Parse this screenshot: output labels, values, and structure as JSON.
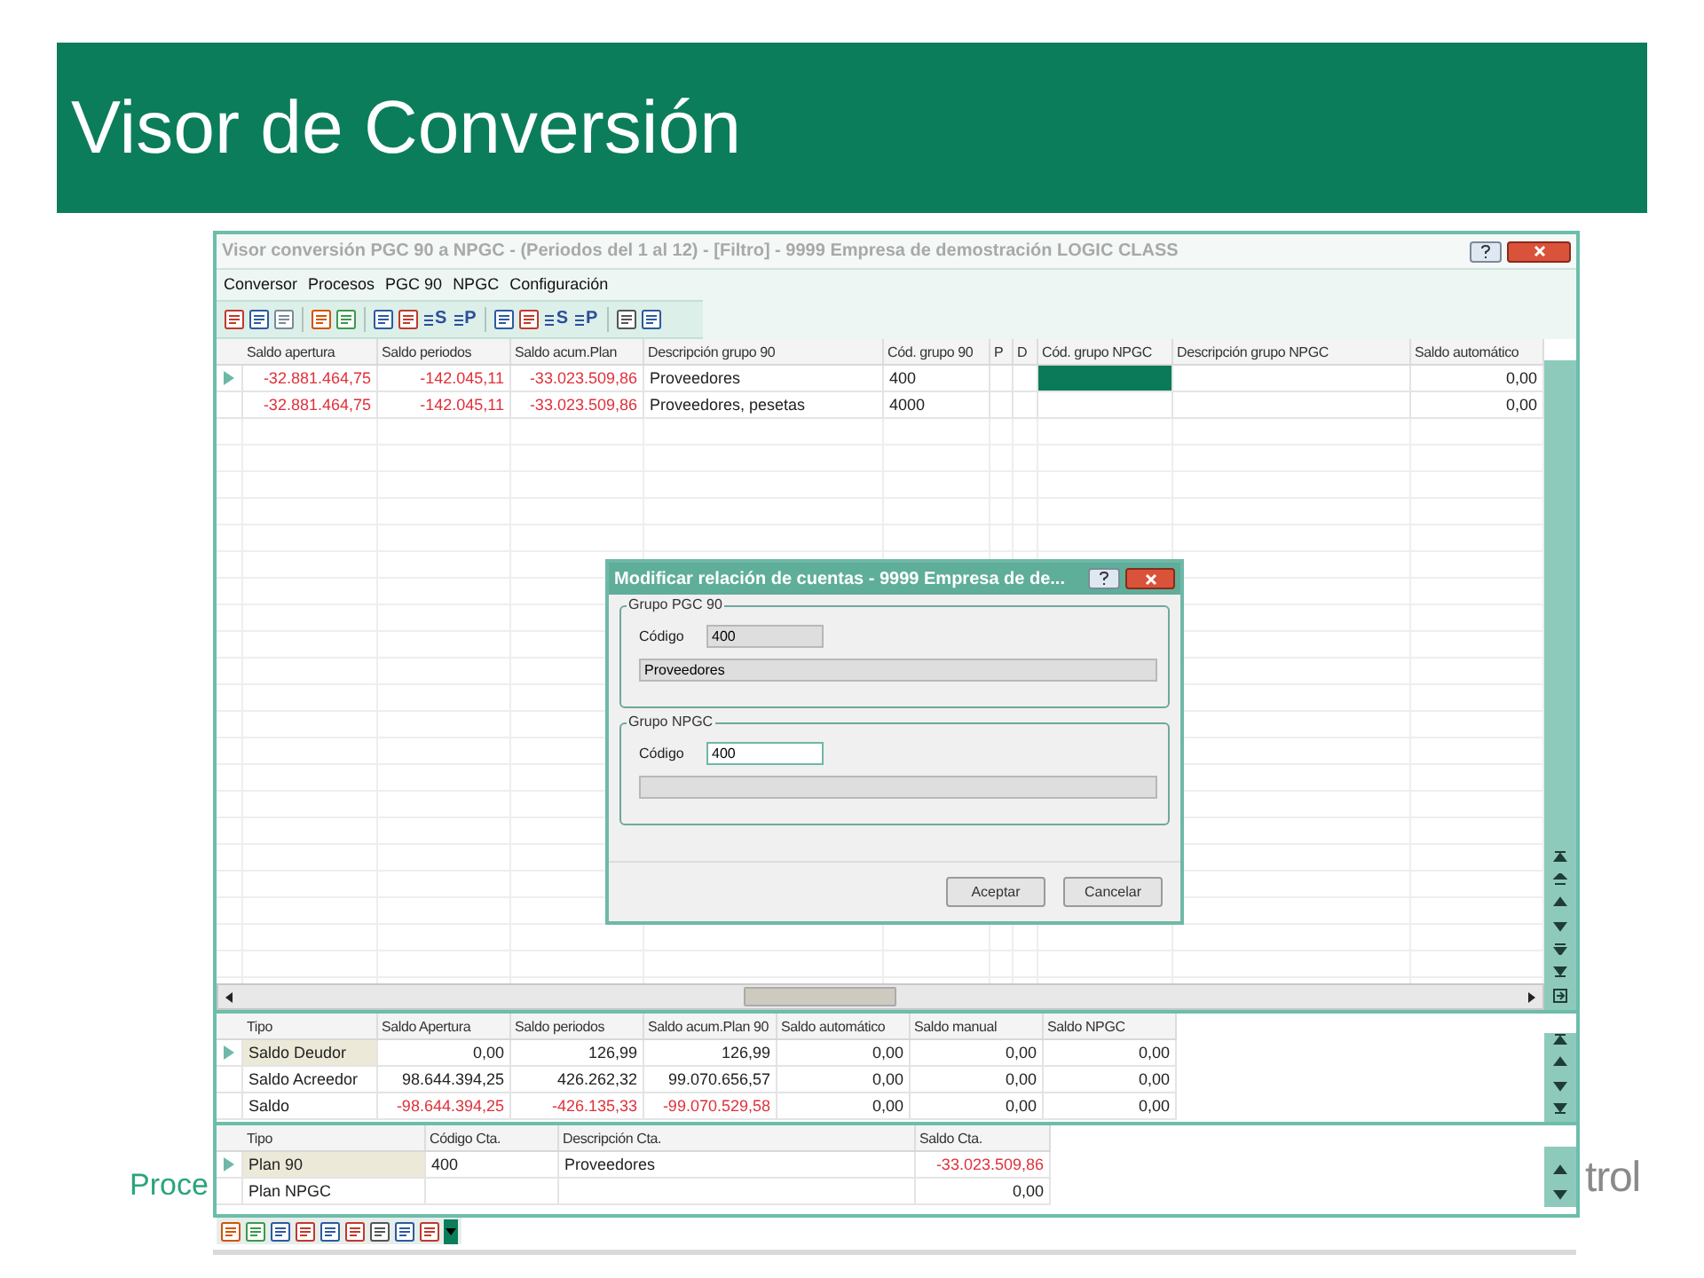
{
  "slide": {
    "title": "Visor de Conversión",
    "footer_left": "Proce",
    "footer_right": "trol"
  },
  "window": {
    "title": "Visor conversión PGC 90 a NPGC - (Periodos del 1 al 12) - [Filtro] - 9999 Empresa de demostración LOGIC CLASS"
  },
  "menu": [
    "Conversor",
    "Procesos",
    "PGC 90",
    "NPGC",
    "Configuración"
  ],
  "toolbar_labels": [
    "S",
    "P",
    "S",
    "P"
  ],
  "grid": {
    "columns": [
      "Saldo apertura",
      "Saldo periodos",
      "Saldo acum.Plan",
      "Descripción grupo 90",
      "Cód. grupo 90",
      "P",
      "D",
      "Cód. grupo NPGC",
      "Descripción grupo NPGC",
      "Saldo automático"
    ],
    "rows": [
      {
        "selected": true,
        "negative": true,
        "saldo_apertura": "-32.881.464,75",
        "saldo_periodos": "-142.045,11",
        "saldo_acum_plan": "-33.023.509,86",
        "descripcion_grupo_90": "Proveedores",
        "cod_grupo_90": "400",
        "saldo_automatico": "0,00"
      },
      {
        "selected": false,
        "negative": true,
        "saldo_apertura": "-32.881.464,75",
        "saldo_periodos": "-142.045,11",
        "saldo_acum_plan": "-33.023.509,86",
        "descripcion_grupo_90": "Proveedores, pesetas",
        "cod_grupo_90": "4000",
        "saldo_automatico": "0,00"
      }
    ]
  },
  "dialog": {
    "title": "Modificar relación de cuentas - 9999 Empresa de de...",
    "groups": [
      {
        "legend": "Grupo PGC 90",
        "code_label": "Código",
        "code_value": "400",
        "description_value": "Proveedores",
        "editable": false
      },
      {
        "legend": "Grupo NPGC",
        "code_label": "Código",
        "code_value": "400",
        "editable": true
      }
    ],
    "buttons": [
      "Aceptar",
      "Cancelar"
    ]
  },
  "summary": {
    "columns": [
      "Tipo",
      "Saldo Apertura",
      "Saldo periodos",
      "Saldo acum.Plan 90",
      "Saldo automático",
      "Saldo manual",
      "Saldo NPGC"
    ],
    "rows": [
      {
        "selected": true,
        "negative": false,
        "tipo": "Saldo Deudor",
        "saldo_apertura": "0,00",
        "saldo_periodos": "126,99",
        "saldo_acum_plan": "126,99",
        "saldo_automatico": "0,00",
        "saldo_manual": "0,00",
        "saldo_npgc": "0,00"
      },
      {
        "selected": false,
        "negative": false,
        "tipo": "Saldo Acreedor",
        "saldo_apertura": "98.644.394,25",
        "saldo_periodos": "426.262,32",
        "saldo_acum_plan": "99.070.656,57",
        "saldo_automatico": "0,00",
        "saldo_manual": "0,00",
        "saldo_npgc": "0,00"
      },
      {
        "selected": false,
        "negative": true,
        "tipo": "Saldo",
        "saldo_apertura": "-98.644.394,25",
        "saldo_periodos": "-426.135,33",
        "saldo_acum_plan": "-99.070.529,58",
        "saldo_automatico": "0,00",
        "saldo_manual": "0,00",
        "saldo_npgc": "0,00"
      }
    ]
  },
  "accounts": {
    "columns": [
      "Tipo",
      "Código Cta.",
      "Descripción Cta.",
      "Saldo Cta."
    ],
    "rows": [
      {
        "selected": true,
        "negative": true,
        "tipo": "Plan 90",
        "codigo": "400",
        "descripcion": "Proveedores",
        "saldo": "-33.023.509,86"
      },
      {
        "selected": false,
        "negative": false,
        "tipo": "Plan NPGC",
        "saldo": "0,00"
      }
    ]
  }
}
